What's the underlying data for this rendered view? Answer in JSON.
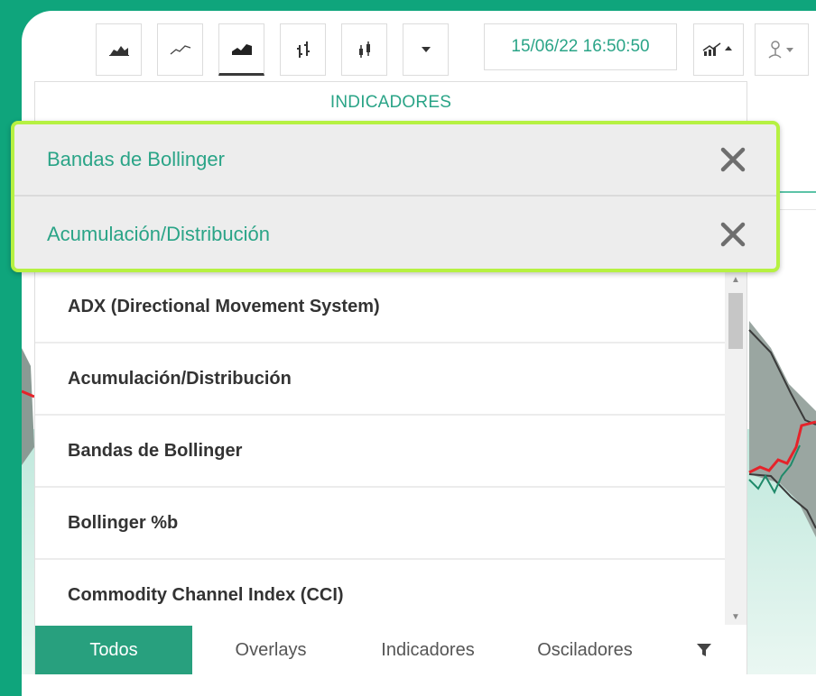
{
  "toolbar": {
    "datetime": "15/06/22 16:50:50",
    "chart_types": [
      {
        "icon": "mountain-chart-icon"
      },
      {
        "icon": "line-chart-icon"
      },
      {
        "icon": "area-chart-icon"
      },
      {
        "icon": "ohlc-bars-icon"
      },
      {
        "icon": "candlestick-icon"
      },
      {
        "icon": "dropdown-caret-icon"
      }
    ],
    "tools": [
      {
        "icon": "indicators-menu-icon"
      },
      {
        "icon": "drawing-tools-icon"
      }
    ]
  },
  "panel": {
    "header": "INDICADORES",
    "active_indicators": [
      {
        "label": "Bandas de Bollinger"
      },
      {
        "label": "Acumulación/Distribución"
      }
    ],
    "list_items": [
      {
        "label": "ADX (Directional Movement System)"
      },
      {
        "label": "Acumulación/Distribución"
      },
      {
        "label": "Bandas de Bollinger"
      },
      {
        "label": "Bollinger %b"
      },
      {
        "label": "Commodity Channel Index (CCI)"
      }
    ],
    "filters": [
      {
        "label": "Todos"
      },
      {
        "label": "Overlays"
      },
      {
        "label": "Indicadores"
      },
      {
        "label": "Osciladores"
      }
    ],
    "active_filter": "Todos"
  },
  "colors": {
    "brand_green": "#28a07e",
    "text_green": "#2aa487",
    "highlight": "#b6f142",
    "series_red": "#e5232a"
  }
}
